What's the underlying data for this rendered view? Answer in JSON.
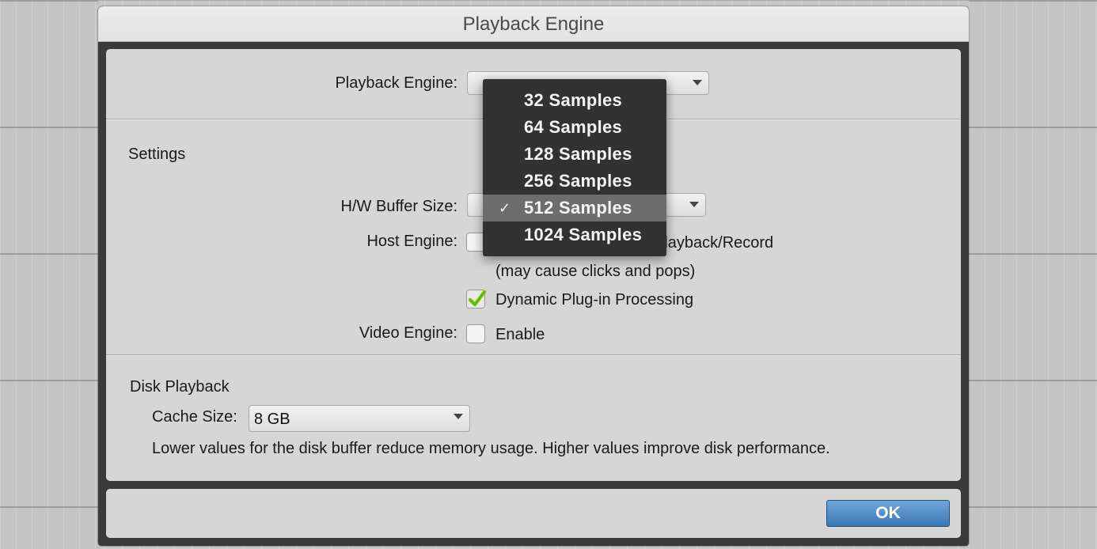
{
  "window": {
    "title": "Playback Engine"
  },
  "engine_row": {
    "label": "Playback Engine:"
  },
  "settings": {
    "heading": "Settings",
    "hw_buffer_label": "H/W Buffer Size:",
    "host_engine_label": "Host Engine:",
    "error_suppression_suffix": "Playback/Record",
    "clicks_note": "(may cause clicks and pops)",
    "dynamic_plugin_label": "Dynamic Plug-in Processing",
    "dynamic_plugin_checked": true,
    "video_engine_label": "Video Engine:",
    "video_enable_label": "Enable",
    "video_enable_checked": false
  },
  "buffer_dropdown": {
    "items": [
      {
        "label": "32 Samples",
        "selected": false
      },
      {
        "label": "64 Samples",
        "selected": false
      },
      {
        "label": "128 Samples",
        "selected": false
      },
      {
        "label": "256 Samples",
        "selected": false
      },
      {
        "label": "512 Samples",
        "selected": true
      },
      {
        "label": "1024 Samples",
        "selected": false
      }
    ],
    "check_glyph": "✓"
  },
  "disk": {
    "heading": "Disk Playback",
    "cache_label": "Cache Size:",
    "cache_value": "8 GB",
    "note": "Lower values for the disk buffer reduce memory usage.  Higher values improve disk performance."
  },
  "footer": {
    "ok_label": "OK"
  },
  "colors": {
    "ok_button": "#3c77b3",
    "menu_bg": "#323232",
    "menu_selected": "#6d6d6d",
    "checkmark": "#7ac70c"
  }
}
